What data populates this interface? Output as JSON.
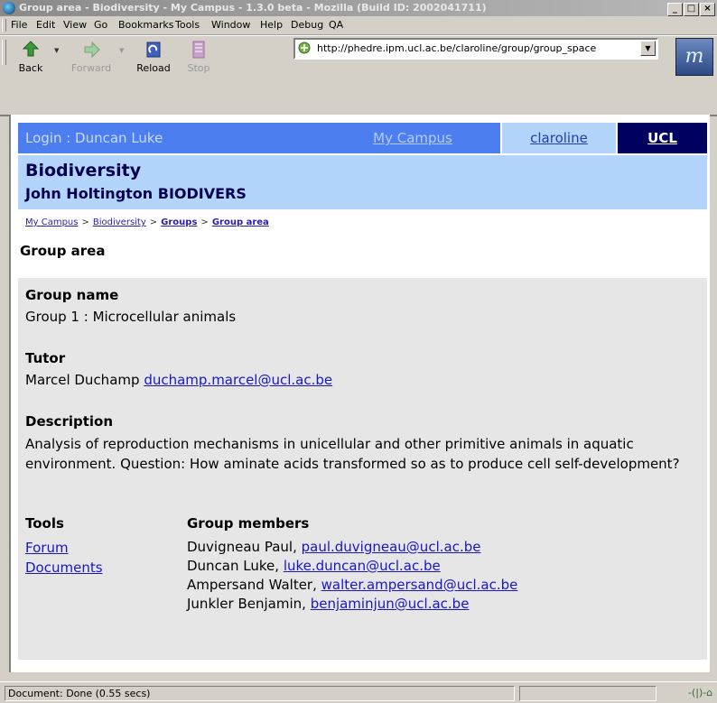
{
  "window": {
    "title": "Group area - Biodiversity - My Campus - 1.3.0 beta - Mozilla (Build ID: 2002041711)",
    "min": "_",
    "max": "□",
    "close": "×"
  },
  "menu": [
    "File",
    "Edit",
    "View",
    "Go",
    "Bookmarks",
    "Tools",
    "Window",
    "Help",
    "Debug",
    "QA"
  ],
  "toolbar": {
    "back": "Back",
    "forward": "Forward",
    "reload": "Reload",
    "stop": "Stop",
    "url": "http://phedre.ipm.ucl.ac.be/claroline/group/group_space"
  },
  "banner": {
    "login": "Login : Duncan Luke",
    "mycampus": "My Campus",
    "claroline": "claroline",
    "ucl": "UCL"
  },
  "course": {
    "title": "Biodiversity",
    "subtitle": "John Holtington BIODIVERS"
  },
  "breadcrumb": [
    "My Campus",
    "Biodiversity",
    "Groups",
    "Group area"
  ],
  "page": {
    "title": "Group area",
    "group_name_label": "Group name",
    "group_name": "Group 1 : Microcellular animals",
    "tutor_label": "Tutor",
    "tutor_name": "Marcel Duchamp",
    "tutor_email": "duchamp.marcel@ucl.ac.be",
    "description_label": "Description",
    "description": "Analysis of reproduction mechanisms in unicellular and other primitive animals in aquatic environment. Question: How aminate acids transformed so as to produce cell self-development?",
    "tools_label": "Tools",
    "tools": [
      "Forum",
      "Documents"
    ],
    "members_label": "Group members",
    "members": [
      {
        "name": "Duvigneau Paul,",
        "email": "paul.duvigneau@ucl.ac.be"
      },
      {
        "name": "Duncan Luke,",
        "email": "luke.duncan@ucl.ac.be"
      },
      {
        "name": "Ampersand Walter,",
        "email": "walter.ampersand@ucl.ac.be"
      },
      {
        "name": "Junkler Benjamin,",
        "email": "benjaminjun@ucl.ac.be"
      }
    ]
  },
  "status": {
    "text": "Document: Done (0.55 secs)"
  }
}
